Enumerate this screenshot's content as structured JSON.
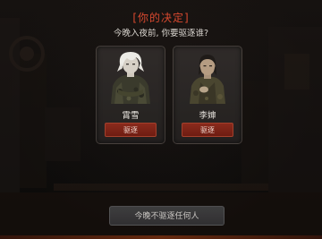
{
  "dialog": {
    "title": "[你的决定]",
    "subtitle": "今晚入夜前, 你要驱逐谁?"
  },
  "candidates": [
    {
      "name": "霄雪",
      "action_label": "驱逐",
      "portrait_icon": "white-haired-survivor-portrait"
    },
    {
      "name": "李婶",
      "action_label": "驱逐",
      "portrait_icon": "older-woman-survivor-portrait"
    }
  ],
  "skip": {
    "label": "今晚不驱逐任何人"
  },
  "colors": {
    "title": "#d9492f",
    "evict_button": "#7a2416",
    "card_background": "#2e2a28"
  }
}
